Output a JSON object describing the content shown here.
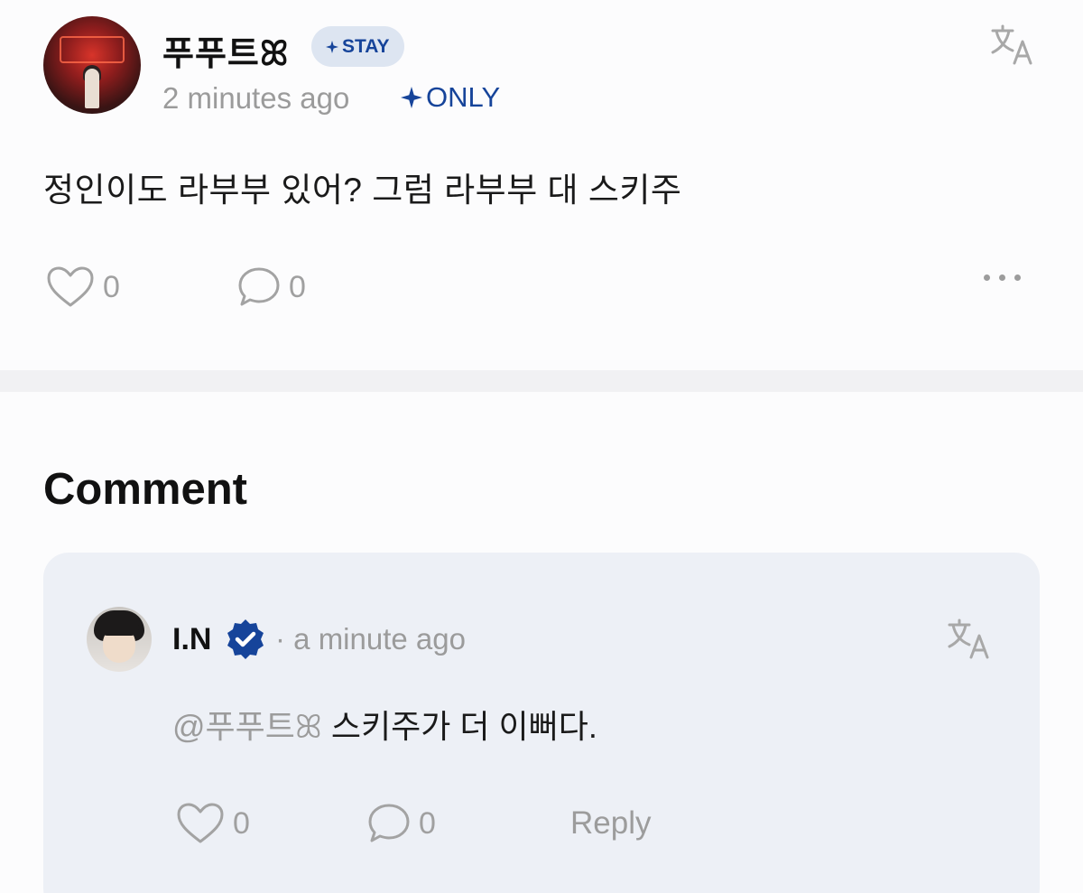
{
  "post": {
    "author": "푸푸트ꕤ",
    "badge": "STAY",
    "time": "2 minutes ago",
    "visibility": "ONLY",
    "body": "정인이도 라부부 있어? 그럼 라부부 대 스키주",
    "likes": "0",
    "comments": "0"
  },
  "comments_section": {
    "heading": "Comment",
    "items": [
      {
        "author": "I.N",
        "verified": true,
        "time_sep": "·",
        "time": "a minute ago",
        "mention": "@푸푸트ꕤ",
        "text": " 스키주가 더 이뻐다.",
        "likes": "0",
        "replies": "0",
        "reply_label": "Reply"
      }
    ]
  },
  "icons": {
    "translate": "translate-icon",
    "like": "heart-icon",
    "comment": "speech-bubble-icon",
    "more": "more-dots-icon",
    "verified": "verified-badge-icon",
    "sparkle": "sparkle-icon"
  },
  "colors": {
    "accent": "#16449a",
    "muted_text": "#9b9b9b",
    "badge_bg": "#dde5f1",
    "comment_card_bg": "#edf0f6"
  }
}
